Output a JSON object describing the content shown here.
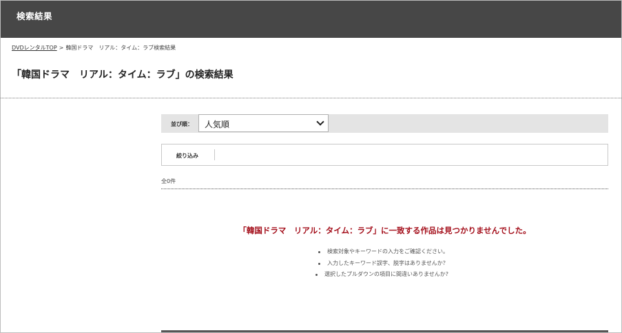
{
  "header": {
    "title": "検索結果"
  },
  "breadcrumb": {
    "home_label": "DVDレンタルTOP",
    "separator": ">",
    "current_label": "韓国ドラマ　リアル：タイム：ラブ検索結果"
  },
  "page": {
    "title": "「韓国ドラマ　リアル：タイム：ラブ」の検索結果"
  },
  "sort": {
    "label": "並び順：",
    "selected": "人気順"
  },
  "filter": {
    "label": "絞り込み"
  },
  "results": {
    "count_text": "全0件",
    "empty_message": "「韓国ドラマ　リアル：タイム：ラブ」に一致する作品は見つかりませんでした。",
    "hints": [
      "検索対象やキーワードの入力をご確認ください。",
      "入力したキーワード誤字、脱字はありませんか？",
      "選択したプルダウンの項目に間違いありませんか?"
    ]
  },
  "colors": {
    "header_bg": "#474747",
    "sort_bar_bg": "#e4e4e4",
    "error_text": "#a40f1b"
  }
}
